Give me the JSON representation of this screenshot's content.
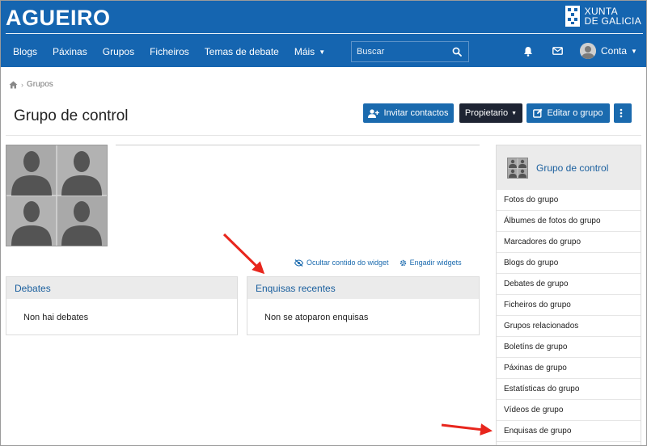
{
  "header": {
    "site_title": "AGUEIRO",
    "logo_line1": "XUNTA",
    "logo_line2": "DE GALICIA",
    "nav": [
      {
        "label": "Blogs"
      },
      {
        "label": "Páxinas"
      },
      {
        "label": "Grupos"
      },
      {
        "label": "Ficheiros"
      },
      {
        "label": "Temas de debate"
      },
      {
        "label": "Máis"
      }
    ],
    "search_placeholder": "Buscar",
    "account_label": "Conta",
    "accent_color": "#1565b0"
  },
  "breadcrumb": {
    "home_icon": "home-icon",
    "current": "Grupos"
  },
  "page": {
    "title": "Grupo de control",
    "buttons": {
      "invite": "Invitar contactos",
      "owner": "Propietario",
      "edit": "Editar o grupo"
    }
  },
  "widget_links": {
    "hide": "Ocultar contido do widget",
    "add": "Engadir widgets"
  },
  "widgets": {
    "debates": {
      "title": "Debates",
      "empty": "Non hai debates"
    },
    "enquisas": {
      "title": "Enquisas recentes",
      "empty": "Non se atoparon enquisas"
    }
  },
  "sidebar": {
    "title": "Grupo de control",
    "items": [
      {
        "label": "Fotos do grupo"
      },
      {
        "label": "Álbumes de fotos do grupo"
      },
      {
        "label": "Marcadores do grupo"
      },
      {
        "label": "Blogs do grupo"
      },
      {
        "label": "Debates de grupo"
      },
      {
        "label": "Ficheiros do grupo"
      },
      {
        "label": "Grupos relacionados"
      },
      {
        "label": "Boletíns de grupo"
      },
      {
        "label": "Páxinas de grupo"
      },
      {
        "label": "Estatísticas do grupo"
      },
      {
        "label": "Vídeos de grupo"
      },
      {
        "label": "Enquisas de grupo"
      }
    ]
  },
  "annotation_color": "#e8261d"
}
